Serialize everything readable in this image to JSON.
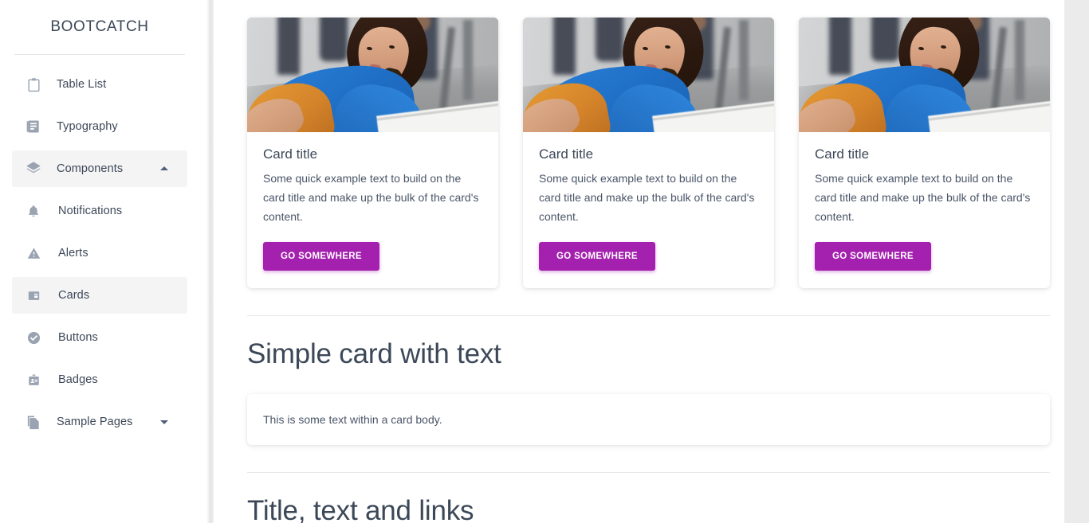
{
  "sidebar": {
    "brand": "BOOTCATCH",
    "items": [
      {
        "label": "Table List",
        "icon": "clipboard-icon",
        "active": false,
        "sub": false,
        "caret": null
      },
      {
        "label": "Typography",
        "icon": "library-books-icon",
        "active": false,
        "sub": false,
        "caret": null
      },
      {
        "label": "Components",
        "icon": "layers-icon",
        "active": true,
        "sub": false,
        "caret": "up"
      },
      {
        "label": "Notifications",
        "icon": "bell-icon",
        "active": false,
        "sub": true,
        "caret": null
      },
      {
        "label": "Alerts",
        "icon": "warning-triangle-icon",
        "active": false,
        "sub": true,
        "caret": null
      },
      {
        "label": "Cards",
        "icon": "web-asset-icon",
        "active": true,
        "sub": true,
        "caret": null
      },
      {
        "label": "Buttons",
        "icon": "check-circle-icon",
        "active": false,
        "sub": true,
        "caret": null
      },
      {
        "label": "Badges",
        "icon": "badge-icon",
        "active": false,
        "sub": true,
        "caret": null
      },
      {
        "label": "Sample Pages",
        "icon": "content-copy-icon",
        "active": false,
        "sub": false,
        "caret": "down"
      }
    ]
  },
  "main": {
    "cards": [
      {
        "title": "Card title",
        "text": "Some quick example text to build on the card title and make up the bulk of the card's content.",
        "button": "GO SOMEWHERE",
        "image_alt": "woman-in-blue-top-photo"
      },
      {
        "title": "Card title",
        "text": "Some quick example text to build on the card title and make up the bulk of the card's content.",
        "button": "GO SOMEWHERE",
        "image_alt": "woman-in-blue-top-photo"
      },
      {
        "title": "Card title",
        "text": "Some quick example text to build on the card title and make up the bulk of the card's content.",
        "button": "GO SOMEWHERE",
        "image_alt": "woman-in-blue-top-photo"
      }
    ],
    "section_simple_card": {
      "heading": "Simple card with text",
      "body_text": "This is some text within a card body."
    },
    "section_title_text_links": {
      "heading": "Title, text and links"
    }
  },
  "colors": {
    "accent": "#a420af",
    "text": "#3c4858",
    "muted": "#4a5568",
    "icon": "#9aa3b1",
    "active_bg": "#f4f4f5",
    "gutter": "#ebebeb"
  }
}
